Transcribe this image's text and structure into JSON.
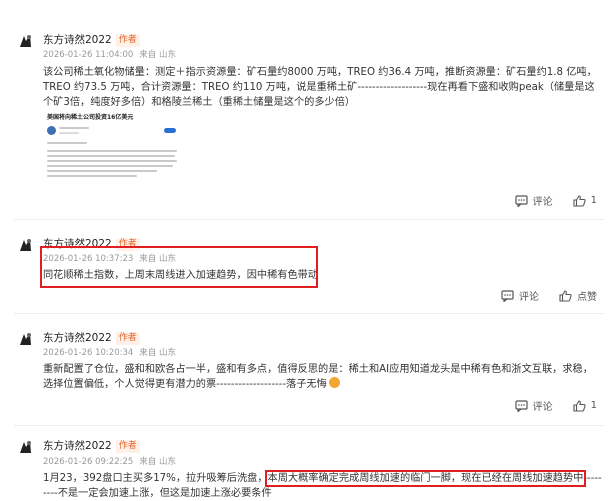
{
  "posts": [
    {
      "author": "东方诗然2022",
      "tag": "作者",
      "time": "2026-01-26 11:04:00",
      "location": "来自 山东",
      "text": "该公司稀土氧化物储量：测定＋指示资源量：矿石量约8000 万吨，TREO 约36.4 万吨，推断资源量：矿石量约1.8 亿吨，TREO 约73.5 万吨，合计资源量：TREO 约110 万吨，说是重稀土矿-------------------现在再看下盛和收购peak（储量是这个矿3倍，纯度好多倍）和格陵兰稀土（重稀土储量是这个的多少倍）",
      "embed_title": "美国将向稀土公司投资16亿美元",
      "comment_label": "评论",
      "like_label": "1"
    },
    {
      "author": "东方诗然2022",
      "tag": "作者",
      "time": "2026-01-26 10:37:23",
      "location": "来自 山东",
      "text": "同花顺稀土指数，上周末周线进入加速趋势，因中稀有色带动",
      "comment_label": "评论",
      "like_label": "点赞"
    },
    {
      "author": "东方诗然2022",
      "tag": "作者",
      "time": "2026-01-26 10:20:34",
      "location": "来自 山东",
      "text": "重新配置了仓位，盛和和欧各占一半，盛和有多点，值得反思的是：稀土和AI应用知道龙头是中稀有色和浙文互联，求稳，选择位置偏低，个人觉得更有潜力的票-------------------落子无悔",
      "comment_label": "评论",
      "like_label": "1"
    },
    {
      "author": "东方诗然2022",
      "tag": "作者",
      "time": "2026-01-26 09:22:25",
      "location": "来自 山东",
      "text_before": "1月23，392盘口主买多17%，拉升吸筹后洗盘，",
      "text_highlight": "本周大概率确定完成周线加速的临门一脚，现在已经在周线加速趋势中",
      "text_after": "---------不是一定会加速上涨，但这是加速上涨必要条件"
    }
  ],
  "colors": {
    "highlight_border": "#e02020",
    "author_tag": "#e0642a"
  }
}
